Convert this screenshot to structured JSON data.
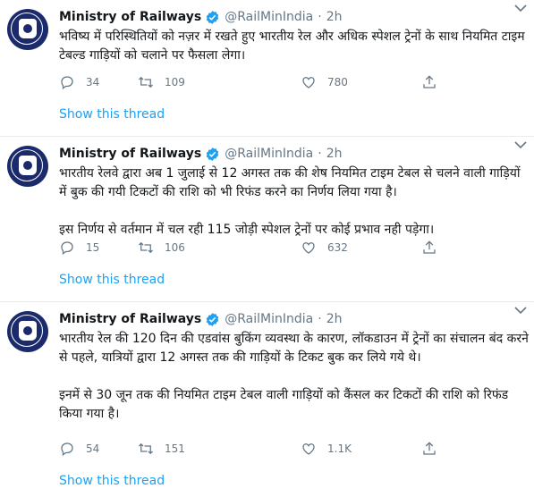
{
  "tweets": [
    {
      "name": "Ministry of Railways",
      "handle": "@RailMinIndia",
      "dot": "·",
      "time": "2h",
      "text": "भविष्य में परिस्थितियों को नज़र में रखते हुए भारतीय रेल और अधिक स्पेशल ट्रेनों के साथ नियमित टाइम टेबल्ड गाड़ियों को चलाने पर फैसला लेगा।",
      "replies": "34",
      "retweets": "109",
      "likes": "780",
      "thread_link": "Show this thread"
    },
    {
      "name": "Ministry of Railways",
      "handle": "@RailMinIndia",
      "dot": "·",
      "time": "2h",
      "text": "भारतीय रेलवे द्वारा अब 1 जुलाई से 12 अगस्त तक की शेष नियमित टाइम टेबल से चलने वाली गाड़ियों में बुक की गयी टिकटों की राशि को भी रिफंड करने का निर्णय लिया गया है।\n\nइस निर्णय से वर्तमान में चल रही 115 जोड़ी स्पेशल ट्रेनों पर कोई प्रभाव नही पड़ेगा।",
      "replies": "15",
      "retweets": "106",
      "likes": "632",
      "thread_link": "Show this thread"
    },
    {
      "name": "Ministry of Railways",
      "handle": "@RailMinIndia",
      "dot": "·",
      "time": "2h",
      "text": "भारतीय रेल की 120 दिन की एडवांस बुकिंग व्यवस्था के  कारण, लॉकडाउन में ट्रेनों का संचालन बंद करने से पहले, यात्रियों द्वारा 12 अगस्त तक की गाड़ियों के टिकट बुक कर लिये गये थे।\n\nइनमें से 30 जून तक की नियमित टाइम टेबल वाली गाड़ियों को कैंसल कर टिकटों की राशि को रिफंड किया गया है।",
      "replies": "54",
      "retweets": "151",
      "likes": "1.1K",
      "thread_link": "Show this thread"
    }
  ],
  "colors": {
    "link": "#1da1f2",
    "muted": "#657786",
    "verified": "#1da1f2",
    "divider": "#e6ecf0"
  },
  "icons": [
    "reply-icon",
    "retweet-icon",
    "like-icon",
    "share-icon",
    "verified-badge-icon",
    "caret-down-icon"
  ]
}
